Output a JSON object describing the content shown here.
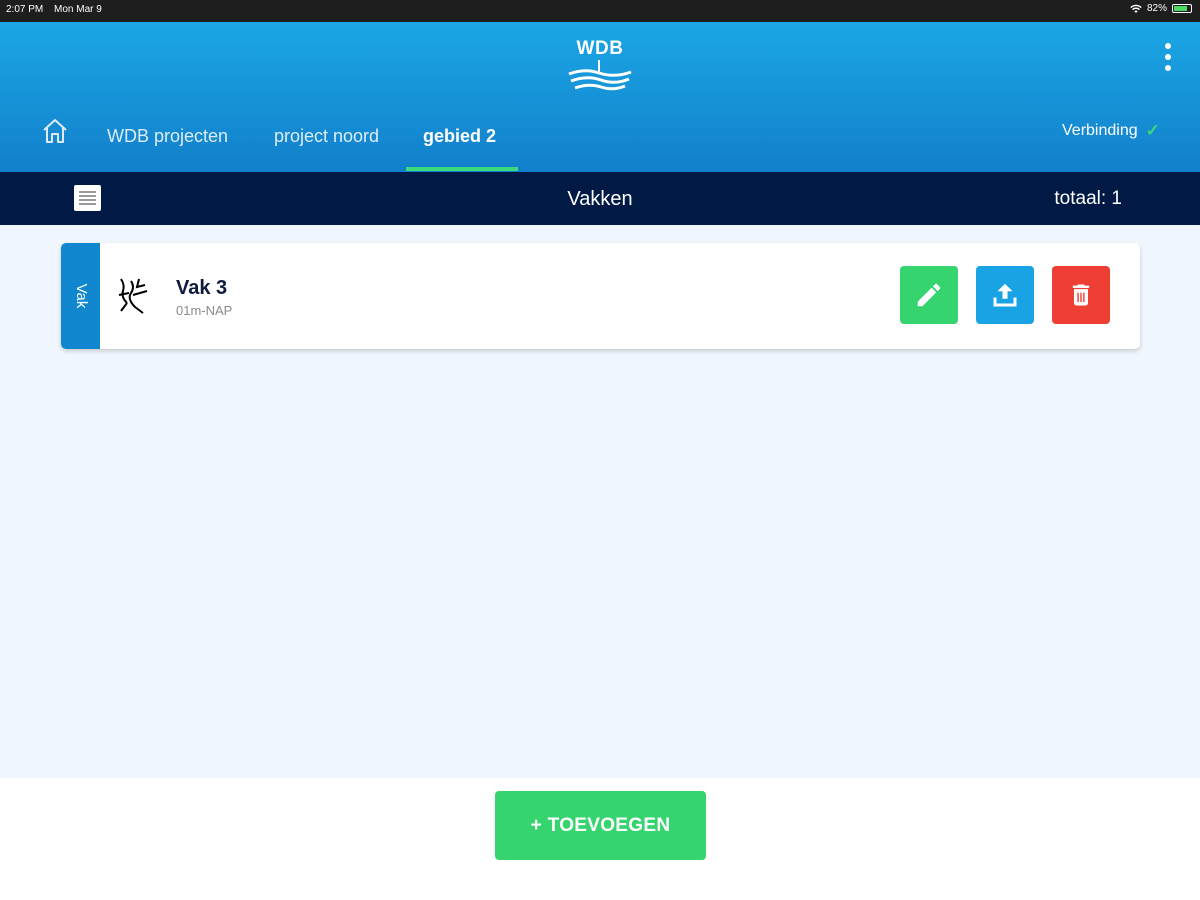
{
  "status_bar": {
    "time": "2:07 PM",
    "date": "Mon Mar 9",
    "battery": "82%"
  },
  "header": {
    "logo_text": "WDB",
    "breadcrumbs": [
      {
        "label": "WDB projecten"
      },
      {
        "label": "project noord"
      },
      {
        "label": "gebied 2"
      }
    ],
    "connection_label": "Verbinding",
    "connection_icon": "check-icon"
  },
  "title_bar": {
    "title": "Vakken",
    "total": "totaal: 1"
  },
  "list": {
    "items": [
      {
        "tab_label": "Vak",
        "title": "Vak 3",
        "subtitle": "01m-NAP"
      }
    ]
  },
  "footer": {
    "add_label": "+ TOEVOEGEN"
  },
  "colors": {
    "header_top": "#1ba7e6",
    "header_bottom": "#127fca",
    "title_bar": "#001a45",
    "accent_green": "#35d46f",
    "upload_blue": "#1aa3e4",
    "delete_red": "#ef3f34",
    "card_tab": "#1187d0"
  }
}
